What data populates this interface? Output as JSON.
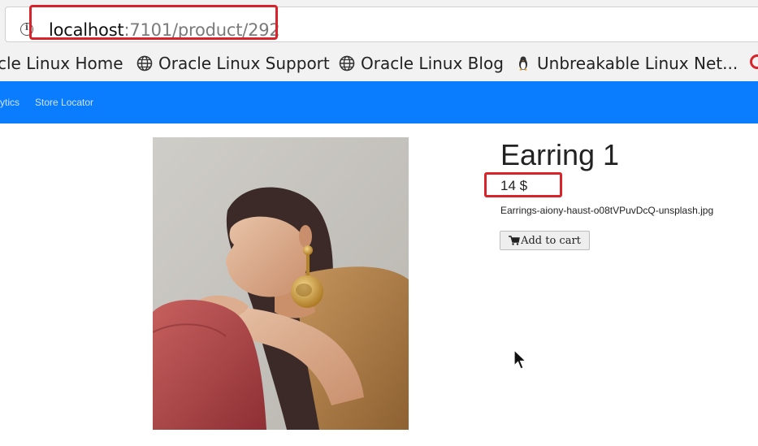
{
  "browser": {
    "url_host": "localhost",
    "url_path": ":7101/product/292"
  },
  "bookmarks": [
    {
      "label": "cle Linux Home",
      "icon": "globe-icon"
    },
    {
      "label": "Oracle Linux Support",
      "icon": "globe-icon"
    },
    {
      "label": "Oracle Linux Blog",
      "icon": "globe-icon"
    },
    {
      "label": "Unbreakable Linux Net...",
      "icon": "penguin-icon"
    }
  ],
  "nav": {
    "items": [
      "ytics",
      "Store Locator"
    ],
    "color": "#0a7dff"
  },
  "product": {
    "title": "Earring 1",
    "price": "14 $",
    "filename": "Earrings-aiony-haust-o08tVPuvDcQ-unsplash.jpg",
    "add_to_cart_label": "Add to cart",
    "cart_icon": "cart-icon"
  },
  "highlight_color": "#d8232a"
}
